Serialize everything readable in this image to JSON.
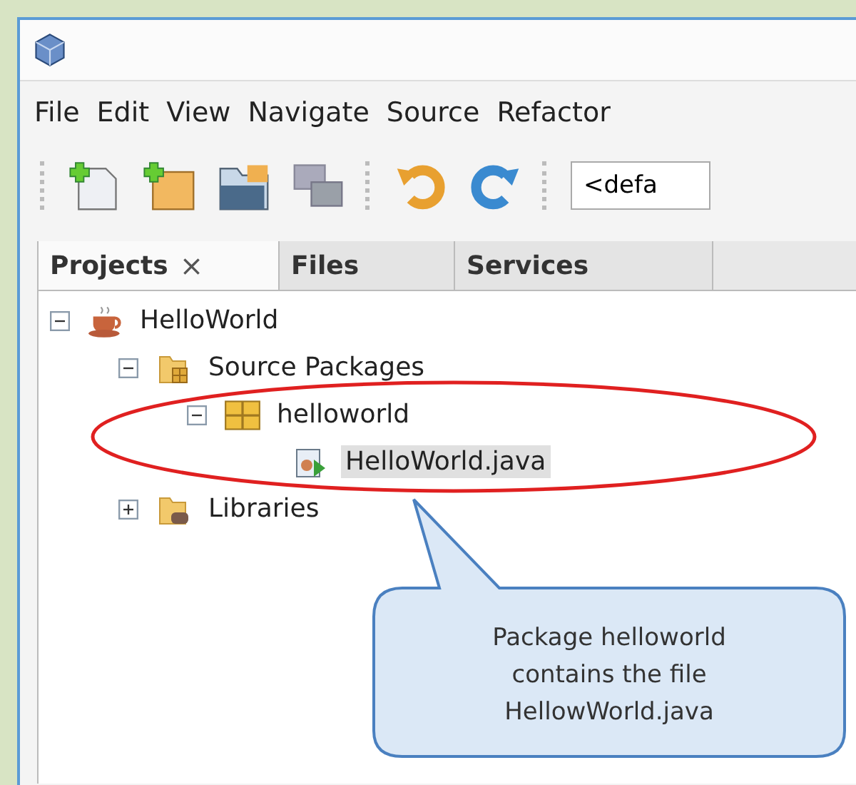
{
  "menu": [
    "File",
    "Edit",
    "View",
    "Navigate",
    "Source",
    "Refactor"
  ],
  "toolbar": {
    "configuration": "<defa"
  },
  "tabs": [
    {
      "label": "Projects",
      "selected": true,
      "close": "×"
    },
    {
      "label": "Files",
      "selected": false
    },
    {
      "label": "Services",
      "selected": false
    }
  ],
  "tree": [
    {
      "label": "HelloWorld",
      "kind": "project",
      "expanded": true,
      "selected": false,
      "children": [
        {
          "label": "Source Packages",
          "kind": "source-root",
          "expanded": true,
          "selected": false,
          "children": [
            {
              "label": "helloworld",
              "kind": "package",
              "expanded": true,
              "selected": false,
              "children": [
                {
                  "label": "HelloWorld.java",
                  "kind": "java-file",
                  "selected": true
                }
              ]
            }
          ]
        },
        {
          "label": "Libraries",
          "kind": "libraries",
          "expanded": false,
          "selected": false
        }
      ]
    }
  ],
  "callout": {
    "text": "Package helloworld\ncontains the file\nHellowWorld.java"
  }
}
